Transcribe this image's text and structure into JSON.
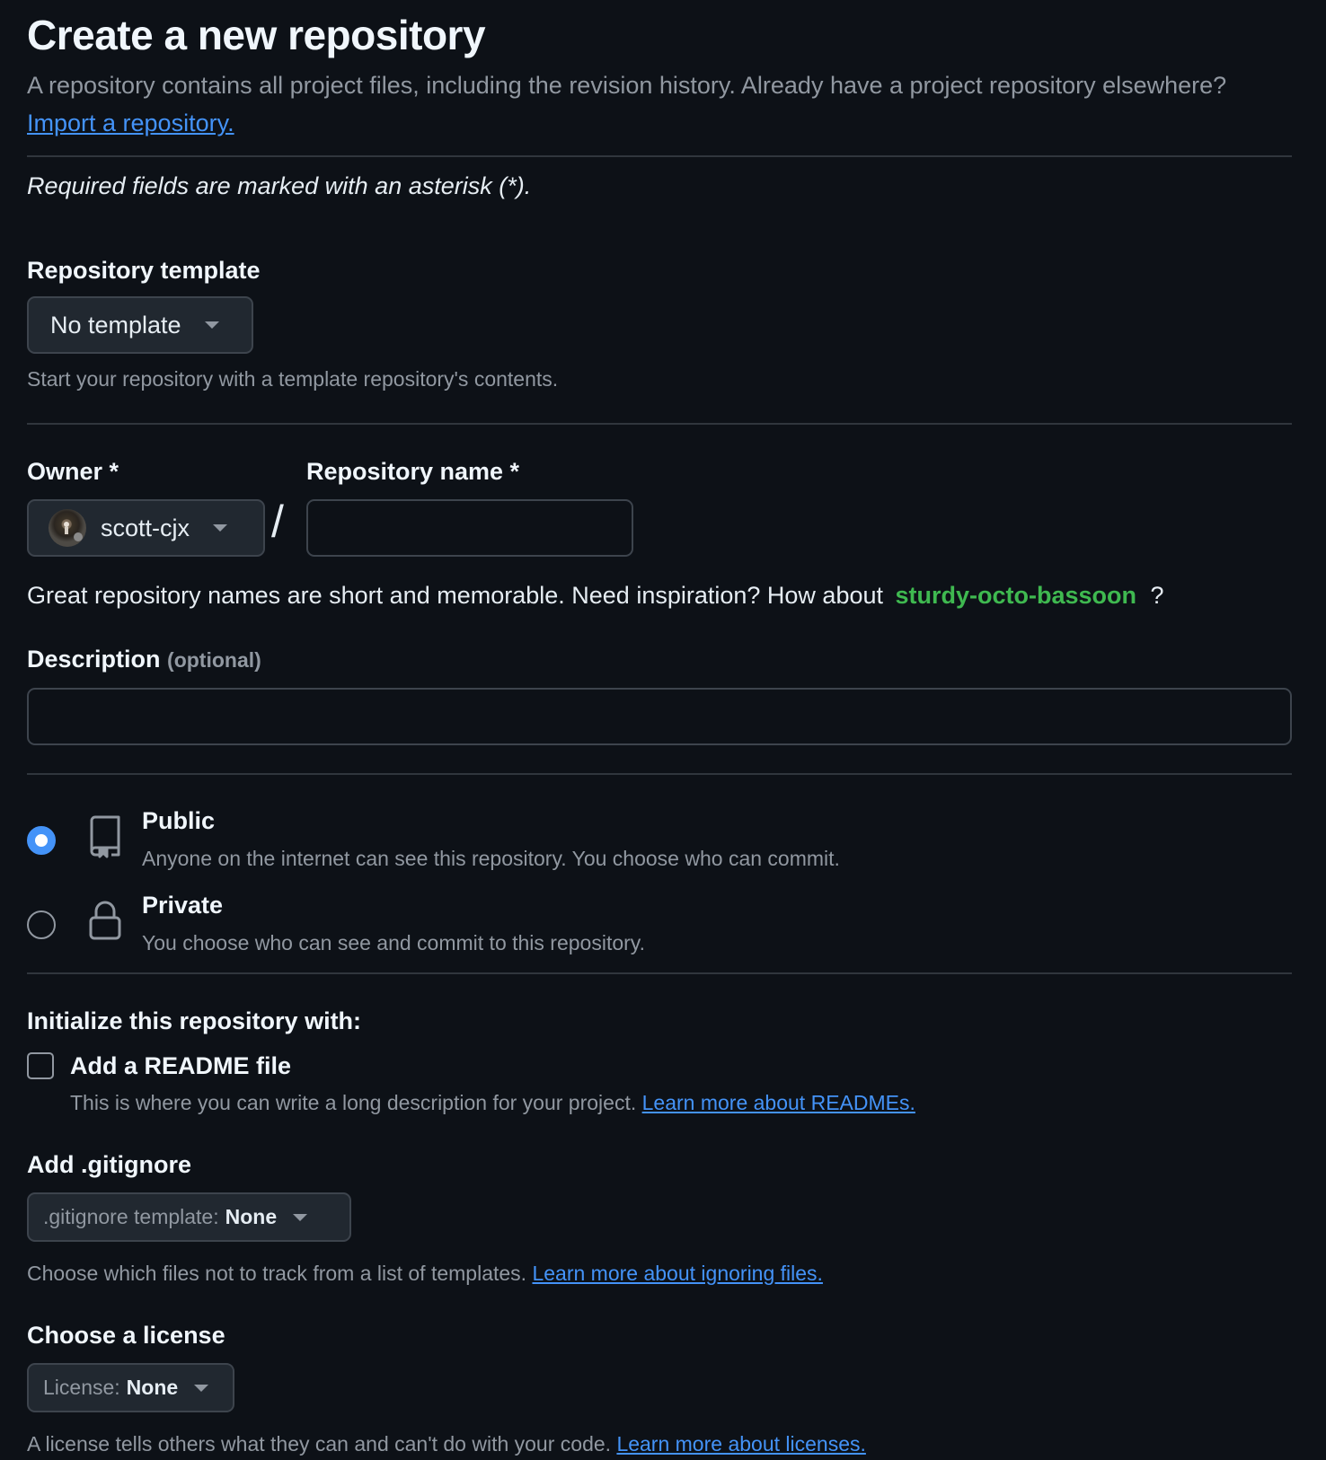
{
  "header": {
    "title": "Create a new repository",
    "subtitle": "A repository contains all project files, including the revision history. Already have a project repository elsewhere?",
    "import_link": "Import a repository."
  },
  "required_note": "Required fields are marked with an asterisk (*).",
  "template": {
    "label": "Repository template",
    "selected": "No template",
    "help": "Start your repository with a template repository's contents."
  },
  "owner": {
    "label": "Owner *",
    "value": "scott-cjx"
  },
  "repo_name": {
    "label": "Repository name *",
    "value": "",
    "slash": "/"
  },
  "suggestion": {
    "text": "Great repository names are short and memorable. Need inspiration? How about",
    "name": "sturdy-octo-bassoon",
    "suffix": "?"
  },
  "description": {
    "label": "Description",
    "optional": "(optional)",
    "value": ""
  },
  "visibility": {
    "selected": "public",
    "public": {
      "title": "Public",
      "desc": "Anyone on the internet can see this repository. You choose who can commit.",
      "icon": "repo-icon"
    },
    "private": {
      "title": "Private",
      "desc": "You choose who can see and commit to this repository.",
      "icon": "lock-icon"
    }
  },
  "initialize": {
    "heading": "Initialize this repository with:",
    "readme": {
      "label": "Add a README file",
      "checked": false,
      "desc": "This is where you can write a long description for your project.",
      "link": "Learn more about READMEs."
    }
  },
  "gitignore": {
    "label": "Add .gitignore",
    "prefix": ".gitignore template:",
    "value": "None",
    "help": "Choose which files not to track from a list of templates.",
    "link": "Learn more about ignoring files."
  },
  "license": {
    "label": "Choose a license",
    "prefix": "License:",
    "value": "None",
    "help": "A license tells others what they can and can't do with your code.",
    "link": "Learn more about licenses."
  },
  "colors": {
    "background": "#0d1117",
    "accent_link": "#4493f8",
    "suggestion_green": "#3fb950",
    "muted_text": "#9198a1",
    "border": "#3d444d"
  }
}
